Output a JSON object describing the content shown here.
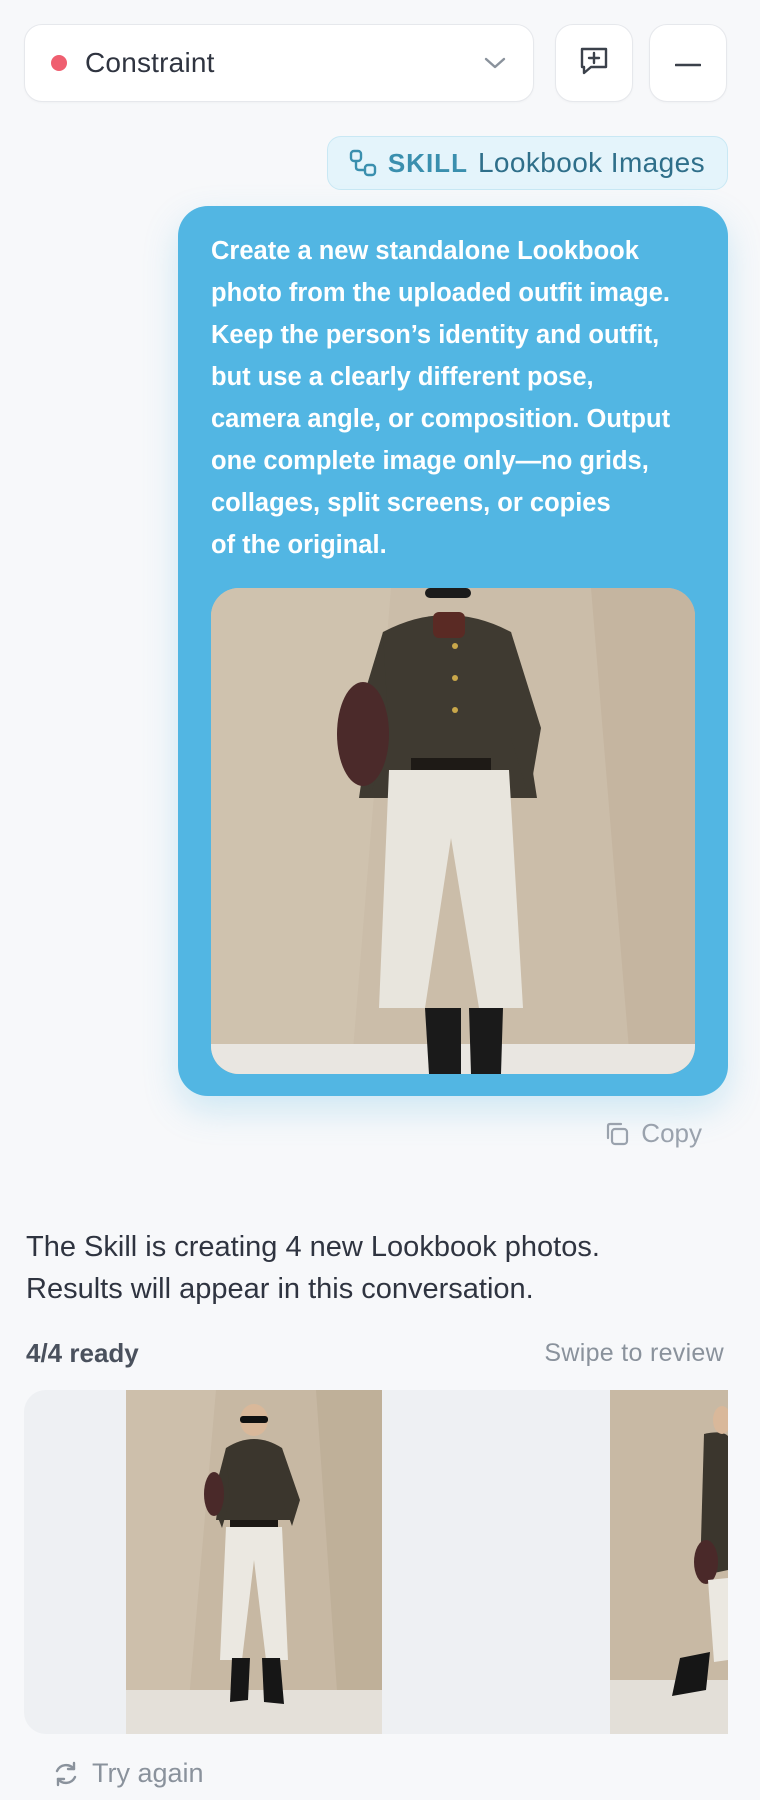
{
  "header": {
    "model_name": "Constraint",
    "status_color": "#ef5f70",
    "icons": [
      "chevron-down-icon",
      "new-chat-icon",
      "minimize-icon"
    ]
  },
  "skill_chip": {
    "tag": "SKILL",
    "name": "Lookbook Images",
    "icon": "skill-link-icon"
  },
  "user_message": {
    "text": "Create a new standalone Lookbook\nphoto from the uploaded outfit image.\nKeep the person’s identity and outfit,\nbut use a clearly different pose,\ncamera angle, or composition. Output\none complete image only—no grids,\ncollages, split screens, or copies\nof the original.",
    "bubble_color": "#52b6e3",
    "copy_label": "Copy"
  },
  "assistant_message": {
    "text": "The Skill is creating 4 new Lookbook photos.\nResults will appear in this conversation.",
    "ready_label": "4/4 ready",
    "swipe_hint": "Swipe to review",
    "try_again_label": "Try again"
  }
}
